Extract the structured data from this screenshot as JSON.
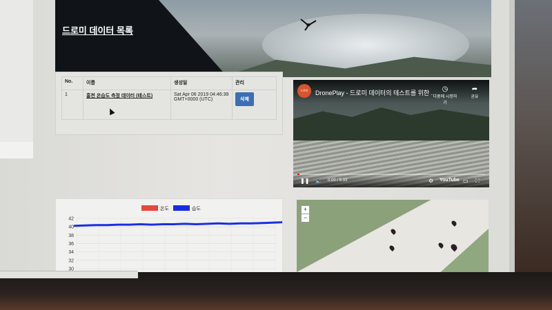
{
  "banner": {
    "title": "드로미 데이터 목록"
  },
  "table": {
    "headers": [
      "No.",
      "이름",
      "생성일",
      "관리"
    ],
    "rows": [
      {
        "no": "1",
        "name": "홍천 온습도 측정 데이터 (테스트)",
        "date": "Sat Apr 06 2019 04:46:39 GMT+0000 (UTC)",
        "action": "삭제"
      }
    ]
  },
  "video": {
    "channel_logo": "드로미",
    "title": "DronePlay - 드로미 데이터의 테스트를 위한 ...",
    "watch_later": "나중에 시청하기",
    "share": "공유",
    "time": "0:00 / 5:33",
    "brand": "YouTube",
    "progress": 0.01
  },
  "chart_data": {
    "type": "line",
    "legend": [
      "온도",
      "습도"
    ],
    "legend_colors": [
      "#e8473b",
      "#1a2ee0"
    ],
    "y_ticks": [
      30,
      32,
      34,
      36,
      38,
      40,
      42
    ],
    "ylim": [
      29,
      42
    ],
    "series": [
      {
        "name": "습도",
        "color": "#1a2ee0",
        "values": [
          40.2,
          40.3,
          40.4,
          40.4,
          40.5,
          40.5,
          40.6,
          40.5,
          40.6,
          40.6,
          40.7,
          40.6,
          40.7,
          40.8,
          40.7,
          40.8,
          40.8,
          40.9,
          41.0,
          41.1
        ]
      }
    ]
  },
  "map": {
    "zoom_in": "+",
    "zoom_out": "−"
  }
}
